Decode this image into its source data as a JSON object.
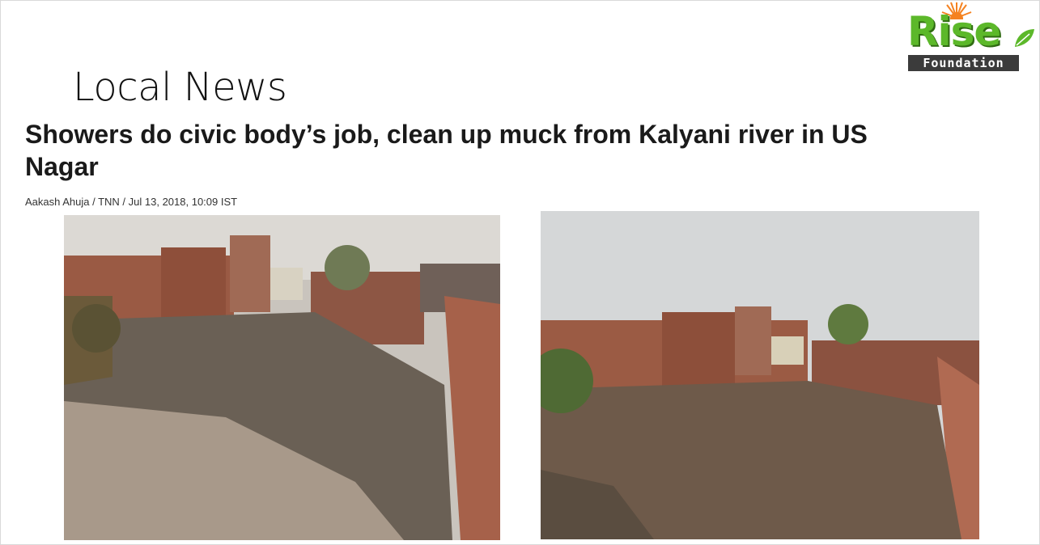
{
  "slide": {
    "title": "Local News"
  },
  "article": {
    "headline": "Showers do civic body’s job, clean up muck from Kalyani river in US Nagar",
    "byline": "Aakash Ahuja / TNN / Jul 13, 2018, 10:09 IST"
  },
  "logo": {
    "name": "Rise",
    "subtitle": "Foundation"
  },
  "colors": {
    "brand_green": "#5cb82a",
    "sun_orange": "#f58220",
    "brick": "#9a5a44",
    "river": "#6e5a4a"
  }
}
